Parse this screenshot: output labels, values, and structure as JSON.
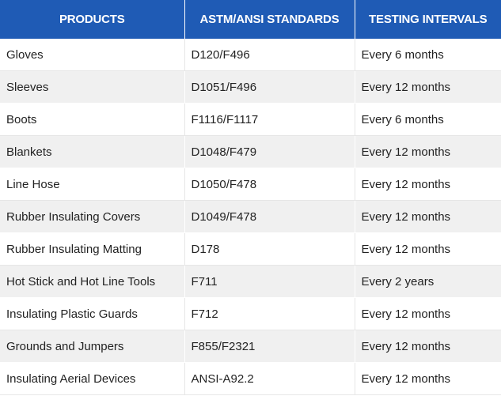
{
  "table": {
    "headers": [
      "PRODUCTS",
      "ASTM/ANSI STANDARDS",
      "TESTING INTERVALS"
    ],
    "rows": [
      [
        "Gloves",
        "D120/F496",
        "Every 6 months"
      ],
      [
        "Sleeves",
        "D1051/F496",
        "Every 12 months"
      ],
      [
        "Boots",
        "F1116/F1117",
        "Every 6 months"
      ],
      [
        "Blankets",
        "D1048/F479",
        "Every 12 months"
      ],
      [
        "Line Hose",
        "D1050/F478",
        "Every 12 months"
      ],
      [
        "Rubber Insulating Covers",
        "D1049/F478",
        "Every 12 months"
      ],
      [
        "Rubber Insulating Matting",
        "D178",
        "Every 12 months"
      ],
      [
        "Hot Stick and Hot Line Tools",
        "F711",
        "Every 2 years"
      ],
      [
        "Insulating Plastic Guards",
        "F712",
        "Every 12 months"
      ],
      [
        "Grounds and Jumpers",
        "F855/F2321",
        "Every 12 months"
      ],
      [
        "Insulating Aerial Devices",
        "ANSI-A92.2",
        "Every 12 months"
      ]
    ]
  },
  "colors": {
    "header_bg": "#1f5bb5",
    "header_text": "#ffffff",
    "row_alt_bg": "#f0f0f0",
    "row_bg": "#ffffff",
    "cell_text": "#222222"
  }
}
